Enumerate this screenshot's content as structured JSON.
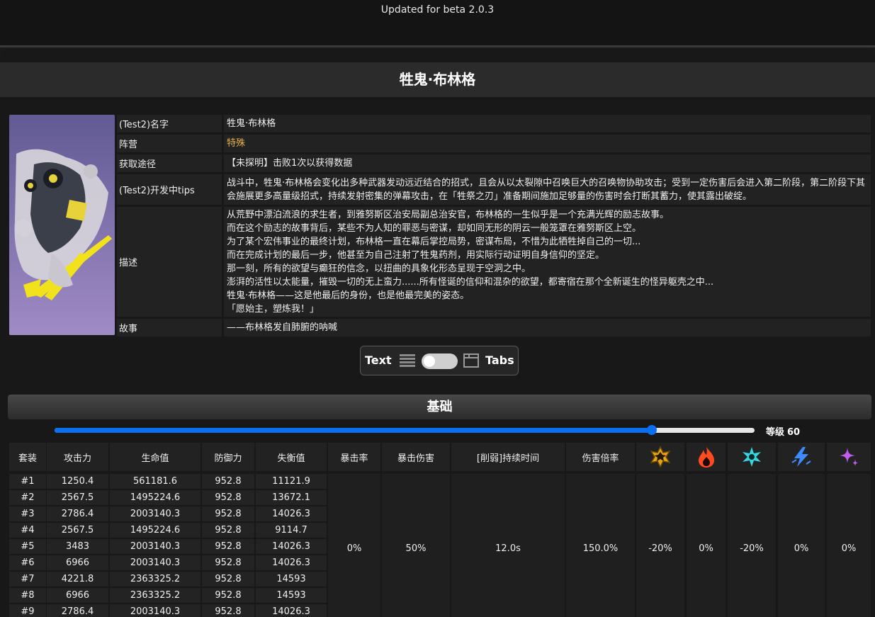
{
  "header": {
    "update_text": "Updated for beta 2.0.3"
  },
  "character": {
    "title": "牲鬼·布林格",
    "info": [
      {
        "key": "(Test2)名字",
        "lines": [
          "牲鬼·布林格"
        ]
      },
      {
        "key": "阵营",
        "lines": [
          "特殊"
        ]
      },
      {
        "key": "获取途径",
        "lines": [
          "【未探明】击败1次以获得数据"
        ]
      },
      {
        "key": "(Test2)开发中tips",
        "lines": [
          "战斗中，牲鬼·布林格会变化出多种武器发动远近结合的招式，且会从以太裂隙中召唤巨大的召唤物协助攻击；受到一定伤害后会进入第二阶段，第二阶段下其会施展更多高量级招式，持续发射密集的弹幕攻击，在「牲祭之刃」准备期间施加足够量的伤害时会打断其蓄力，使其露出破绽。"
        ]
      },
      {
        "key": "描述",
        "lines": [
          "从荒野中漂泊流浪的求生者，到雅努斯区治安局副总治安官，布林格的一生似乎是一个充满光辉的励志故事。",
          "而在这个励志的故事背后，某些不为人知的罪恶与密谋，却如同无形的阴云一般笼罩在雅努斯区上空。",
          "为了某个宏伟事业的最终计划，布林格一直在幕后掌控局势，密谋布局，不惜为此牺牲掉自己的一切...",
          "而在完成计划的最后一步，他甚至为自己注射了牲鬼药剂，用实际行动证明自身信仰的坚定。",
          "那一刻，所有的欲望与癫狂的信念，以扭曲的具象化形态呈现于空洞之中。",
          "澎湃的活性以太能量，摧毁一切的无上蛮力......所有怪诞的信仰和混杂的欲望，都寄宿在那个全新诞生的怪异躯壳之中...",
          "牲鬼·布林格——这是他最后的身份，也是他最完美的姿态。",
          "「愿始主，塑炼我！」"
        ]
      },
      {
        "key": "故事",
        "lines": [
          "——布林格发自肺腑的呐喊"
        ]
      }
    ]
  },
  "view_toggle": {
    "text_label": "Text",
    "tabs_label": "Tabs",
    "list_icon": "list-icon",
    "tab_icon": "tab-window-icon"
  },
  "section": {
    "title": "基础"
  },
  "level_slider": {
    "label": "等级",
    "value": 60,
    "max": 70,
    "fraction": 0.853
  },
  "stats_table": {
    "headers": [
      "套装",
      "攻击力",
      "生命值",
      "防御力",
      "失衡值",
      "暴击率",
      "暴击伤害",
      "[削弱]持续时间",
      "伤害倍率"
    ],
    "element_icons": [
      {
        "name": "physical-element-icon",
        "color": "#e8a317"
      },
      {
        "name": "fire-element-icon",
        "color": "#ff4b1f"
      },
      {
        "name": "ice-element-icon",
        "color": "#36d6e0"
      },
      {
        "name": "electric-element-icon",
        "color": "#3c8cff"
      },
      {
        "name": "ether-element-icon",
        "color": "#c45cf0"
      }
    ],
    "rows": [
      [
        "#1",
        "1250.4",
        "561181.6",
        "952.8",
        "11121.9"
      ],
      [
        "#2",
        "2567.5",
        "1495224.6",
        "952.8",
        "13672.1"
      ],
      [
        "#3",
        "2786.4",
        "2003140.3",
        "952.8",
        "14026.3"
      ],
      [
        "#4",
        "2567.5",
        "1495224.6",
        "952.8",
        "9114.7"
      ],
      [
        "#5",
        "3483",
        "2003140.3",
        "952.8",
        "14026.3"
      ],
      [
        "#6",
        "6966",
        "2003140.3",
        "952.8",
        "14026.3"
      ],
      [
        "#7",
        "4221.8",
        "2363325.2",
        "952.8",
        "14593"
      ],
      [
        "#8",
        "6966",
        "2363325.2",
        "952.8",
        "14593"
      ],
      [
        "#9",
        "2786.4",
        "2003140.3",
        "952.8",
        "14026.3"
      ]
    ],
    "shared": [
      "0%",
      "50%",
      "12.0s",
      "150.0%",
      "-20%",
      "0%",
      "-20%",
      "0%",
      "0%"
    ]
  }
}
